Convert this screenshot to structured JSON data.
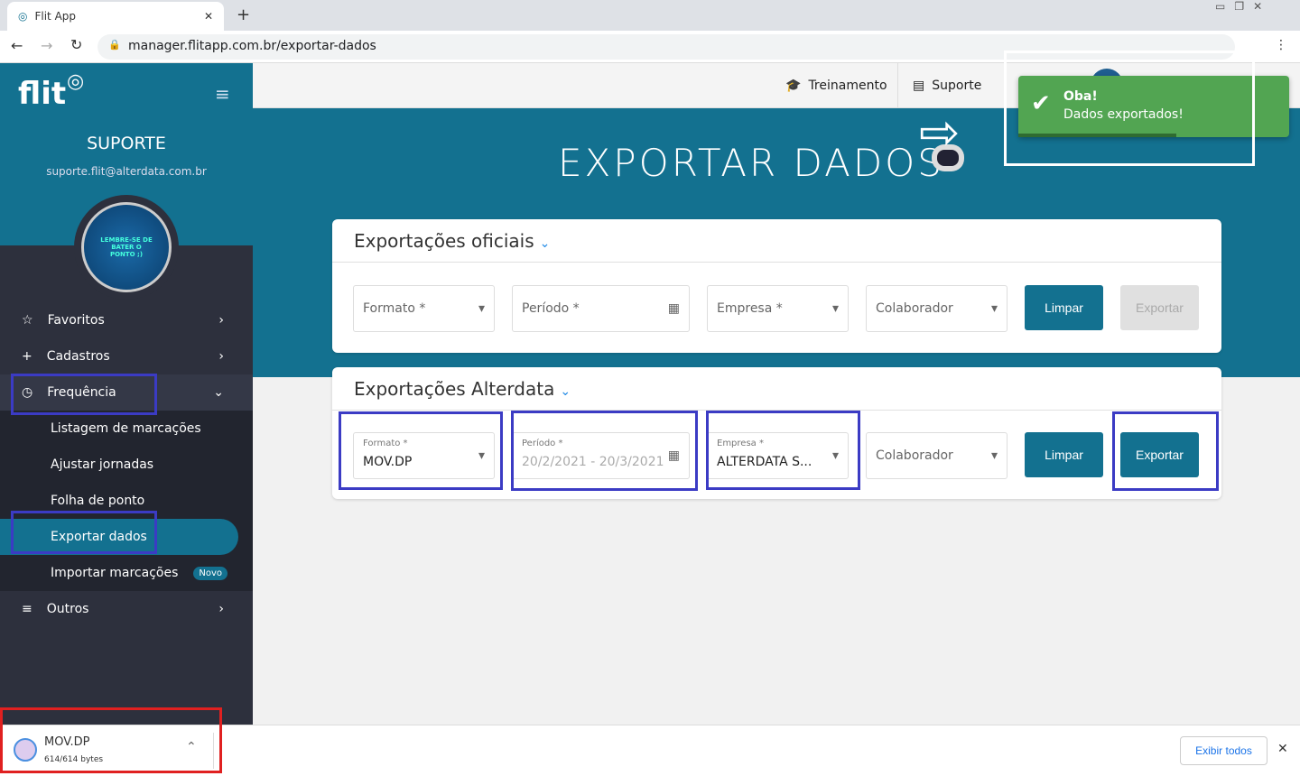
{
  "browser": {
    "tab_title": "Flit App",
    "url": "manager.flitapp.com.br/exportar-dados"
  },
  "sidebar": {
    "logo": "flit",
    "user_name": "SUPORTE",
    "user_email": "suporte.flit@alterdata.com.br",
    "avatar_text": "LEMBRE-SE DE BATER O PONTO ;)",
    "items": [
      {
        "label": "Favoritos"
      },
      {
        "label": "Cadastros"
      },
      {
        "label": "Frequência"
      },
      {
        "label": "Listagem de marcações"
      },
      {
        "label": "Ajustar jornadas"
      },
      {
        "label": "Folha de ponto"
      },
      {
        "label": "Exportar dados"
      },
      {
        "label": "Importar marcações",
        "badge": "Novo"
      },
      {
        "label": "Outros"
      }
    ]
  },
  "topbar": {
    "training": "Treinamento",
    "support": "Suporte"
  },
  "page": {
    "title": "EXPORTAR DADOS"
  },
  "toast": {
    "title": "Oba!",
    "message": "Dados exportados!",
    "progress": 0.6,
    "color": "#52a552"
  },
  "official": {
    "title": "Exportações oficiais",
    "format": "Formato *",
    "period": "Período *",
    "company": "Empresa *",
    "employee": "Colaborador",
    "clear": "Limpar",
    "export": "Exportar"
  },
  "alterdata": {
    "title": "Exportações Alterdata",
    "format_label": "Formato *",
    "format_value": "MOV.DP",
    "period_label": "Período *",
    "period_value": "20/2/2021 - 20/3/2021",
    "company_label": "Empresa *",
    "company_value": "ALTERDATA S...",
    "employee": "Colaborador",
    "clear": "Limpar",
    "export": "Exportar"
  },
  "download": {
    "filename": "MOV.DP",
    "size": "614/614 bytes",
    "show_all": "Exibir todos"
  }
}
